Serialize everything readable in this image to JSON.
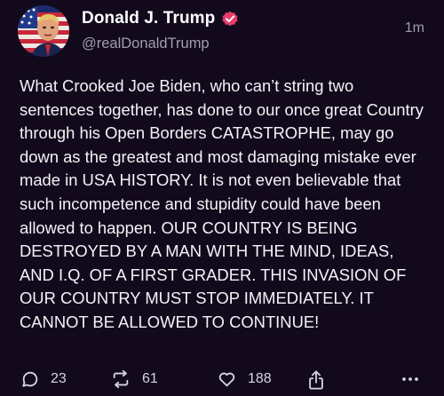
{
  "post": {
    "author": {
      "display_name": "Donald J. Trump",
      "handle": "@realDonaldTrump",
      "verified": true
    },
    "timestamp": "1m",
    "text": "What Crooked Joe Biden, who can’t string two sentences together, has done to our once great Country through his Open Borders CATASTROPHE, may go down as the greatest and most damaging mistake ever made in USA HISTORY. It is not even believable that such incompetence and stupidity could have been allowed to happen. OUR COUNTRY IS BEING DESTROYED BY A MAN WITH THE MIND, IDEAS, AND I.Q. OF A FIRST GRADER. THIS INVASION OF OUR COUNTRY MUST STOP IMMEDIATELY. IT CANNOT BE ALLOWED TO CONTINUE!",
    "actions": {
      "replies": "23",
      "reposts": "61",
      "likes": "188"
    }
  },
  "icons": {
    "reply": "speech-bubble-icon",
    "repost": "repost-arrows-icon",
    "like": "heart-icon",
    "share": "share-upload-icon",
    "more": "ellipsis-icon",
    "verified": "verified-badge-icon"
  },
  "colors": {
    "background": "#120a1c",
    "text": "#f4f2f7",
    "muted": "#a39bb0",
    "verified_badge": "#e63d6b"
  }
}
